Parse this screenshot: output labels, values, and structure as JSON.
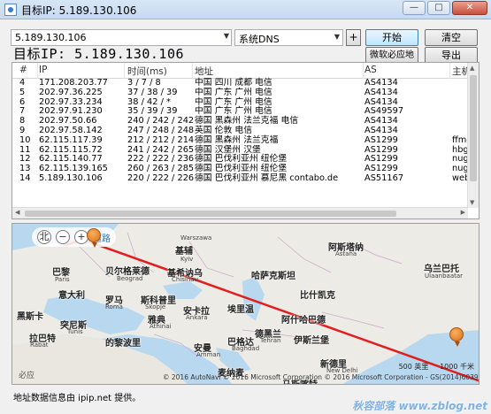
{
  "window": {
    "title": "目标IP: 5.189.130.106"
  },
  "toolbar": {
    "ip_value": "5.189.130.106",
    "dns_value": "系统DNS",
    "plus_label": "+",
    "start_label": "开始",
    "clear_label": "清空",
    "weiruan_label": "微软必应地图",
    "export_label": "导出"
  },
  "target": {
    "label": "目标IP: 5.189.130.106"
  },
  "table": {
    "headers": [
      "#",
      "IP",
      "时间(ms)",
      "地址",
      "AS",
      "主机"
    ],
    "rows": [
      [
        "4",
        "171.208.203.77",
        "3 / 7 / 8",
        "中国 四川 成都 电信",
        "AS4134",
        ""
      ],
      [
        "5",
        "202.97.36.225",
        "37 / 38 / 39",
        "中国 广东 广州 电信",
        "AS4134",
        ""
      ],
      [
        "6",
        "202.97.33.234",
        "38 / 42 / *",
        "中国 广东 广州 电信",
        "AS4134",
        ""
      ],
      [
        "7",
        "202.97.91.230",
        "35 / 39 / 39",
        "中国 广东 广州 电信",
        "AS49597",
        ""
      ],
      [
        "8",
        "202.97.50.66",
        "240 / 242 / 242",
        "德国 黑森州 法兰克福 电信",
        "AS4134",
        ""
      ],
      [
        "9",
        "202.97.58.142",
        "247 / 248 / 248",
        "英国 伦敦 电信",
        "AS4134",
        ""
      ],
      [
        "10",
        "62.115.117.39",
        "212 / 212 / 214",
        "德国 黑森州 法兰克福",
        "AS1299",
        "ffm-"
      ],
      [
        "11",
        "62.115.115.72",
        "241 / 242 / 265",
        "德国 汉堡州 汉堡",
        "AS1299",
        "hbg"
      ],
      [
        "12",
        "62.115.140.77",
        "222 / 222 / 236",
        "德国 巴伐利亚州 纽伦堡",
        "AS1299",
        "nug"
      ],
      [
        "13",
        "62.115.139.165",
        "260 / 263 / 285",
        "德国 巴伐利亚州 纽伦堡",
        "AS1299",
        "nug"
      ],
      [
        "14",
        "5.189.130.106",
        "220 / 222 / 226",
        "德国 巴伐利亚州 慕尼黑 contabo.de",
        "AS51167",
        "web"
      ]
    ]
  },
  "map": {
    "controls": {
      "north": "北",
      "zoom_out": "−",
      "zoom_in": "+",
      "road": "道路"
    },
    "labels": [
      {
        "t": "基辅"
      },
      {
        "t": "阿斯塔纳"
      },
      {
        "t": "巴黎"
      },
      {
        "t": "贝尔格莱德"
      },
      {
        "t": "基希讷乌"
      },
      {
        "t": "乌兰巴托"
      },
      {
        "t": "意大利"
      },
      {
        "t": "罗马"
      },
      {
        "t": "斯科普里"
      },
      {
        "t": "哈萨克斯坦"
      },
      {
        "t": "比什凯克"
      },
      {
        "t": "黑斯卡"
      },
      {
        "t": "雅典"
      },
      {
        "t": "安卡拉"
      },
      {
        "t": "埃里温"
      },
      {
        "t": "突尼斯"
      },
      {
        "t": "阿什哈巴德"
      },
      {
        "t": "拉巴特"
      },
      {
        "t": "的黎波里"
      },
      {
        "t": "德黑兰"
      },
      {
        "t": "伊斯兰堡"
      },
      {
        "t": "安曼"
      },
      {
        "t": "巴格达"
      },
      {
        "t": "新德里"
      },
      {
        "t": "麦纳麦"
      },
      {
        "t": "马斯喀特"
      },
      {
        "t": "阿布扎比"
      }
    ],
    "sublabels": [
      {
        "t": "Warszawa"
      },
      {
        "t": "Kyiv"
      },
      {
        "t": "Paris"
      },
      {
        "t": "Beograd"
      },
      {
        "t": "Chisinau"
      },
      {
        "t": "Roma"
      },
      {
        "t": "Ankara"
      },
      {
        "t": "Skopje"
      },
      {
        "t": "Athinai"
      },
      {
        "t": "Tunis"
      },
      {
        "t": "Rabat"
      },
      {
        "t": "Baghdad"
      },
      {
        "t": "Amman"
      },
      {
        "t": "Tehran"
      },
      {
        "t": "Astana"
      },
      {
        "t": "Ulaanbaatar"
      },
      {
        "t": "New Delhi"
      }
    ],
    "scale_km": "500 英里",
    "scale_km2": "1000 千米",
    "bing": "必应",
    "copyright": "© 2016 AutoNavi © 2016 Microsoft Corporation © 2016 Microsoft Corporation - GS(2014)6039"
  },
  "footer": {
    "text": "地址数据信息由 ipip.net 提供。"
  },
  "watermark": "秋容部落 www.zblog.net"
}
